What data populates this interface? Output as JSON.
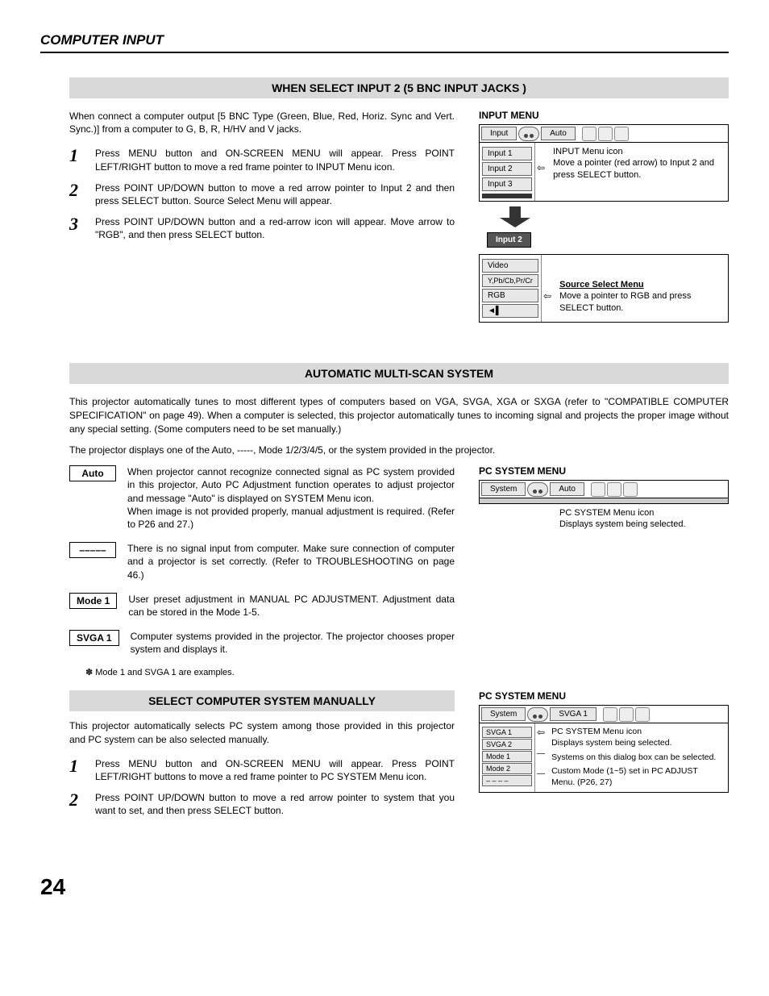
{
  "header": "COMPUTER INPUT",
  "section1": {
    "title": "WHEN SELECT INPUT 2 (5 BNC INPUT JACKS )",
    "intro": "When connect a computer output [5 BNC Type (Green, Blue, Red, Horiz. Sync and Vert. Sync.)] from a computer to G, B, R, H/HV and V jacks.",
    "steps": [
      "Press MENU button and ON-SCREEN MENU will appear.  Press POINT LEFT/RIGHT button to move a red frame pointer to INPUT Menu icon.",
      "Press POINT UP/DOWN button to move a red arrow pointer to Input 2 and then press SELECT button.  Source Select Menu will appear.",
      "Press POINT UP/DOWN button and a red-arrow icon will appear.  Move arrow to \"RGB\", and then press SELECT button."
    ],
    "input_menu": {
      "title": "INPUT MENU",
      "toolbar_input": "Input",
      "toolbar_auto": "Auto",
      "items": [
        "Input 1",
        "Input 2",
        "Input 3"
      ],
      "annotation1_title": "INPUT Menu icon",
      "annotation1": "Move a pointer (red arrow) to Input 2 and press SELECT button.",
      "chip": "Input 2",
      "source_items": [
        "Video",
        "Y,Pb/Cb,Pr/Cr",
        "RGB"
      ],
      "annotation2_title": "Source Select Menu",
      "annotation2": "Move a pointer to RGB and press SELECT button."
    }
  },
  "section2": {
    "title": "AUTOMATIC MULTI-SCAN SYSTEM",
    "para1": "This projector automatically tunes to most different types of computers based on VGA, SVGA, XGA or SXGA (refer to \"COMPATIBLE COMPUTER SPECIFICATION\" on page 49).  When a computer is selected, this projector automatically tunes to incoming signal and projects the proper image without any special setting.  (Some computers need to be set manually.)",
    "para2": "The projector displays one of the Auto, -----, Mode 1/2/3/4/5, or the system provided in the projector.",
    "modes": [
      {
        "label": "Auto",
        "text": "When projector cannot recognize connected signal as PC system provided in this projector, Auto PC Adjustment function operates to adjust projector and message \"Auto\" is displayed on SYSTEM Menu icon.\nWhen image is not provided properly, manual adjustment is required.  (Refer to P26 and 27.)"
      },
      {
        "label": "–––––",
        "text": "There is no signal input from computer.  Make sure connection of computer and a projector is set correctly.  (Refer to TROUBLESHOOTING on page 46.)"
      },
      {
        "label": "Mode 1",
        "text": "User preset adjustment in MANUAL PC ADJUSTMENT.  Adjustment data can be stored in the Mode 1-5."
      },
      {
        "label": "SVGA 1",
        "text": "Computer systems provided in the projector. The projector chooses proper system and displays it."
      }
    ],
    "footnote": "✽  Mode 1 and SVGA 1 are examples.",
    "pc_menu": {
      "title": "PC SYSTEM MENU",
      "toolbar_system": "System",
      "toolbar_auto": "Auto",
      "annotation": "PC SYSTEM Menu icon\nDisplays system being selected."
    }
  },
  "section3": {
    "title": "SELECT COMPUTER SYSTEM MANUALLY",
    "intro": "This projector automatically selects PC system among those provided in this projector and PC system can be also selected manually.",
    "steps": [
      "Press MENU button and ON-SCREEN MENU will appear.  Press POINT LEFT/RIGHT buttons to move a red frame pointer to PC SYSTEM Menu icon.",
      "Press POINT UP/DOWN button to move a red arrow pointer to system that you want to set, and then press SELECT button."
    ],
    "pc_menu2": {
      "title": "PC SYSTEM MENU",
      "toolbar_system": "System",
      "toolbar_value": "SVGA 1",
      "items": [
        "SVGA 1",
        "SVGA 2",
        "Mode 1",
        "Mode 2",
        "– – – –"
      ],
      "annotation1": "PC SYSTEM Menu icon\nDisplays system being selected.",
      "annotation2": "Systems on this dialog box can be selected.",
      "annotation3": "Custom Mode (1~5) set in PC ADJUST Menu.  (P26, 27)"
    }
  },
  "page_number": "24"
}
